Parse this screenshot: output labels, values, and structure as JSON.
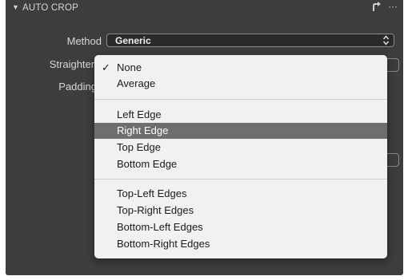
{
  "header": {
    "title": "AUTO CROP",
    "collapse_icon": "triangle-down-icon",
    "reset_icon": "reset-arrow-icon",
    "more": "···"
  },
  "rows": {
    "method_label": "Method",
    "straighten_label": "Straighten",
    "padding_label": "Padding"
  },
  "method_select": {
    "value": "Generic",
    "arrows_icon": "up-down-chevron-icon"
  },
  "menu": {
    "checkmark": "✓",
    "group1": [
      "None",
      "Average"
    ],
    "group2": [
      "Left Edge",
      "Right Edge",
      "Top Edge",
      "Bottom Edge"
    ],
    "group3": [
      "Top-Left Edges",
      "Top-Right Edges",
      "Bottom-Left Edges",
      "Bottom-Right Edges"
    ],
    "checked_item": "None",
    "highlighted_item": "Right Edge"
  },
  "colors": {
    "panel_bg": "#3d3d3d",
    "menu_bg": "#f1f1f1",
    "highlight": "#6e6e6e"
  }
}
